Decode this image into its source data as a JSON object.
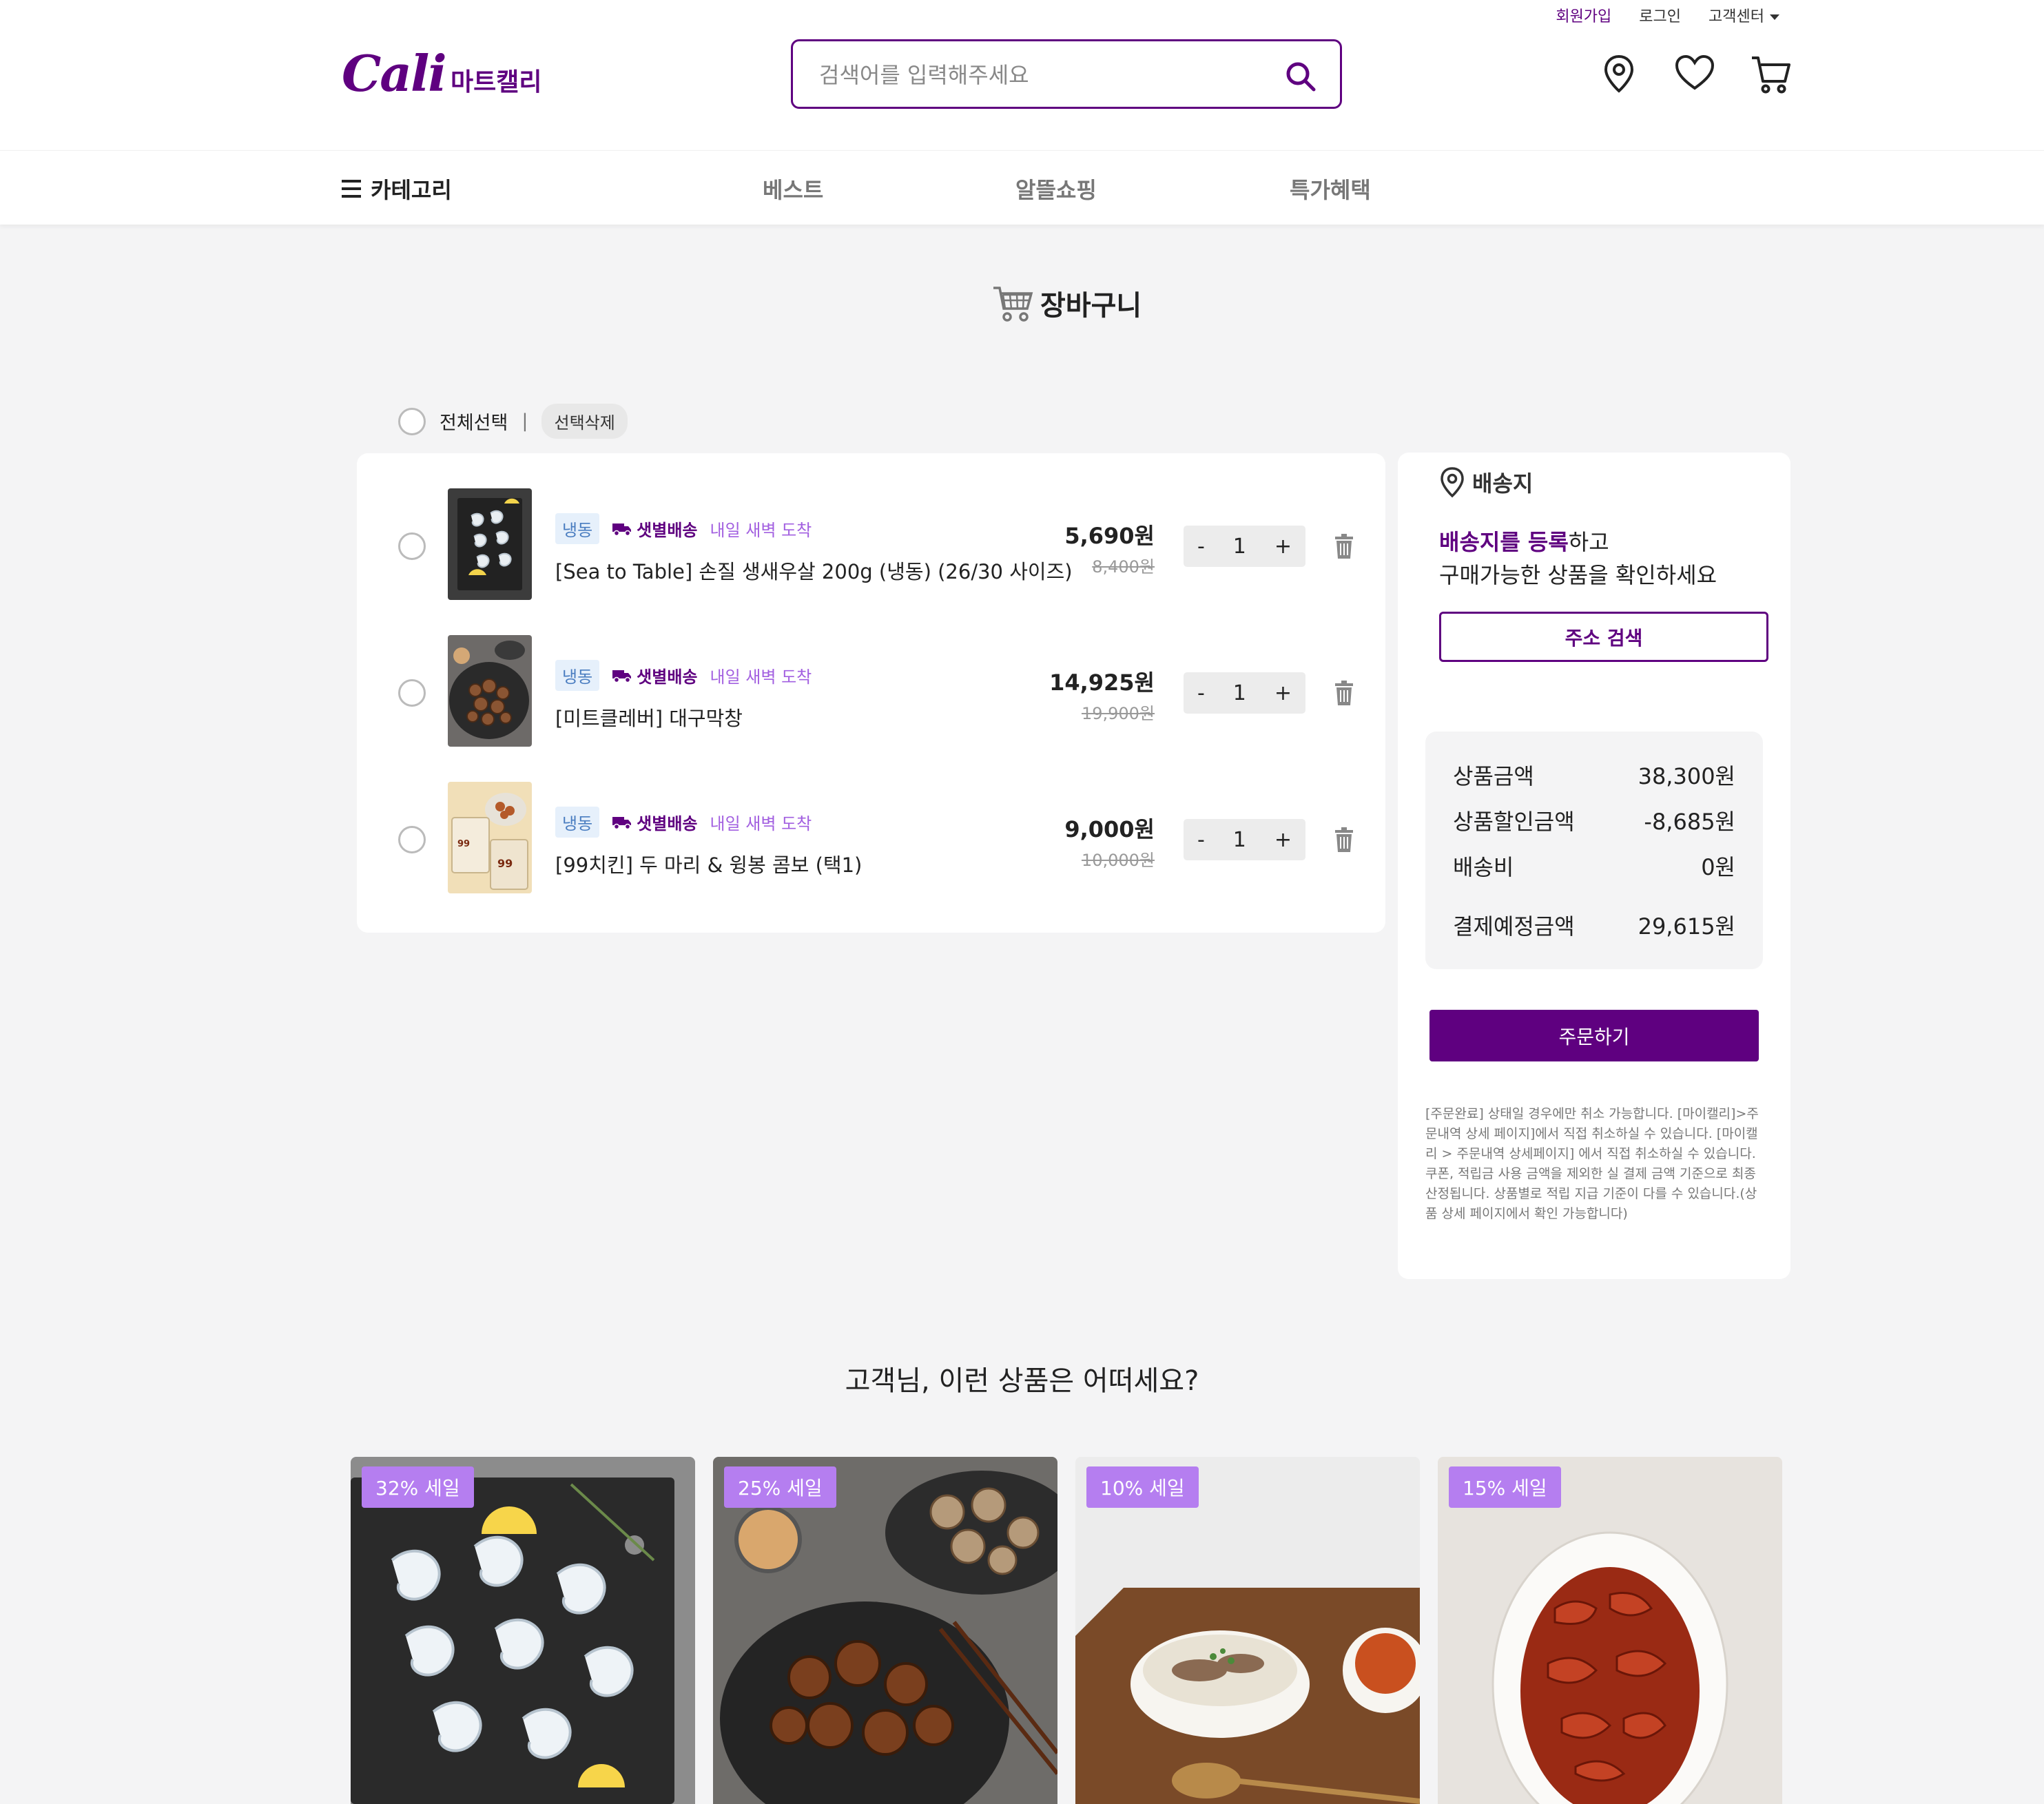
{
  "header": {
    "top_links": {
      "signup": "회원가입",
      "login": "로그인",
      "customer_center": "고객센터"
    },
    "logo": "Cali",
    "mart_label": "마트캘리",
    "search_placeholder": "검색어를 입력해주세요",
    "icons": [
      "location-icon",
      "heart-icon",
      "cart-icon"
    ]
  },
  "nav": {
    "category": "카테고리",
    "tabs": [
      "베스트",
      "알뜰쇼핑",
      "특가혜택"
    ]
  },
  "page_title": "장바구니",
  "select_all": {
    "label": "전체선택",
    "separator": "|",
    "delete_selected": "선택삭제"
  },
  "cart_items": [
    {
      "tag_storage": "냉동",
      "tag_delivery": "샛별배송",
      "tag_arrival": "내일 새벽 도착",
      "name": "[Sea to Table] 손질 생새우살 200g (냉동) (26/30 사이즈)",
      "price": "5,690원",
      "original_price": "8,400원",
      "qty": "1"
    },
    {
      "tag_storage": "냉동",
      "tag_delivery": "샛별배송",
      "tag_arrival": "내일 새벽 도착",
      "name": "[미트클레버] 대구막창",
      "price": "14,925원",
      "original_price": "19,900원",
      "qty": "1"
    },
    {
      "tag_storage": "냉동",
      "tag_delivery": "샛별배송",
      "tag_arrival": "내일 새벽 도착",
      "name": "[99치킨] 두 마리 & 윙봉 콤보 (택1)",
      "price": "9,000원",
      "original_price": "10,000원",
      "qty": "1"
    }
  ],
  "stepper": {
    "minus": "-",
    "plus": "+"
  },
  "shipping": {
    "title": "배송지",
    "msg_highlight": "배송지를 등록",
    "msg_rest": "하고",
    "msg_line2": "구매가능한 상품을 확인하세요",
    "address_button": "주소 검색"
  },
  "summary": {
    "product_amount_label": "상품금액",
    "product_amount": "38,300원",
    "discount_label": "상품할인금액",
    "discount": "-8,685원",
    "shipping_fee_label": "배송비",
    "shipping_fee": "0원",
    "total_label": "결제예정금액",
    "total": "29,615원"
  },
  "order_button": "주문하기",
  "notice": "[주문완료] 상태일 경우에만 취소 가능합니다. [마이캘리]>주문내역 상세 페이지]에서 직접 취소하실 수 있습니다. [마이캘리 > 주문내역 상세페이지] 에서 직접 취소하실 수 있습니다. 쿠폰, 적립금 사용 금액을 제외한 실 결제 금액 기준으로 최종 산정됩니다. 상품별로 적립 지급 기준이 다를 수 있습니다.(상품 상세 페이지에서 확인 가능합니다)",
  "recommend": {
    "title": "고객님, 이런 상품은 어떠세요?",
    "badges": [
      "32% 세일",
      "25% 세일",
      "10% 세일",
      "15% 세일"
    ]
  },
  "colors": {
    "brand": "#5f0080",
    "badge": "#b57ef0",
    "arrival": "#a25fe0",
    "background": "#f4f4f5"
  }
}
